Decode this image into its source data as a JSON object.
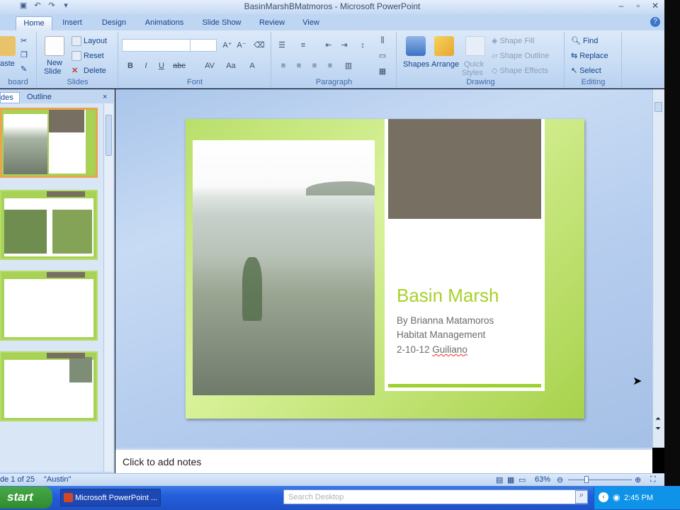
{
  "window": {
    "title": "BasinMarshBMatmoros - Microsoft PowerPoint",
    "controls": [
      "–",
      "▫",
      "✕"
    ]
  },
  "tabs": [
    "Home",
    "Insert",
    "Design",
    "Animations",
    "Slide Show",
    "Review",
    "View"
  ],
  "ribbon": {
    "clipboard": {
      "paste_label": "aste",
      "group_label": "board"
    },
    "slides": {
      "new_slide": "New",
      "new_slide2": "Slide",
      "layout": "Layout",
      "reset": "Reset",
      "delete": "Delete",
      "group_label": "Slides"
    },
    "font": {
      "group_label": "Font",
      "bold": "B",
      "italic": "I",
      "underline": "U",
      "strike": "abc",
      "spacing": "AV",
      "case": "Aa",
      "color": "A"
    },
    "paragraph": {
      "group_label": "Paragraph"
    },
    "drawing": {
      "shapes": "Shapes",
      "arrange": "Arrange",
      "quick_styles": "Quick",
      "quick_styles2": "Styles",
      "shape_fill": "Shape Fill",
      "shape_outline": "Shape Outline",
      "shape_effects": "Shape Effects",
      "group_label": "Drawing"
    },
    "editing": {
      "find": "Find",
      "replace": "Replace",
      "select": "Select",
      "group_label": "Editing"
    }
  },
  "left_pane": {
    "tab_slides": "des",
    "tab_outline": "Outline",
    "close": "×"
  },
  "slide": {
    "title": "Basin Marsh",
    "lines": [
      "By Brianna Matamoros",
      "Habitat Management",
      "2-10-12 "
    ],
    "misspelled": "Guiliano"
  },
  "notes_placeholder": "Click to add notes",
  "status": {
    "slide_info": "de 1 of 25",
    "theme": "\"Austin\"",
    "zoom": "63%"
  },
  "taskbar": {
    "start": "start",
    "task_item": "Microsoft PowerPoint ...",
    "search_placeholder": "Search Desktop",
    "clock": "2:45 PM"
  },
  "colors": {
    "slide_green": "#a8d24c",
    "title_green": "#a8d02c",
    "grey_box": "#766f62",
    "thumb_border_selected": "#e7a64e"
  }
}
